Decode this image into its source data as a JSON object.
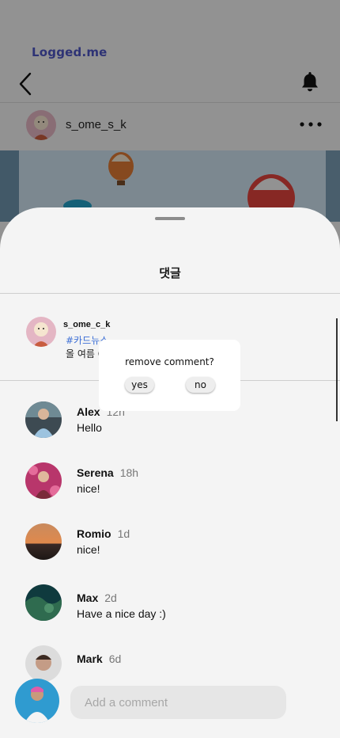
{
  "header": {
    "brand": "Logged.me",
    "author_name": "s_ome_s_k",
    "icons": [
      "back-arrow-icon",
      "bell-icon",
      "more-dots-icon"
    ]
  },
  "sheet": {
    "title": "댓글",
    "caption": {
      "name": "s_ome_c_k",
      "tag": "#카드뉴스",
      "text": "올 여름 O"
    },
    "comments": [
      {
        "name": "Alex",
        "time": "12h",
        "text": "Hello"
      },
      {
        "name": "Serena",
        "time": "18h",
        "text": "nice!"
      },
      {
        "name": "Romio",
        "time": "1d",
        "text": "nice!"
      },
      {
        "name": "Max",
        "time": "2d",
        "text": "Have a nice day :)"
      },
      {
        "name": "Mark",
        "time": "6d",
        "text": ""
      }
    ],
    "input_placeholder": "Add a comment"
  },
  "dialog": {
    "title": "remove comment?",
    "yes": "yes",
    "no": "no"
  }
}
